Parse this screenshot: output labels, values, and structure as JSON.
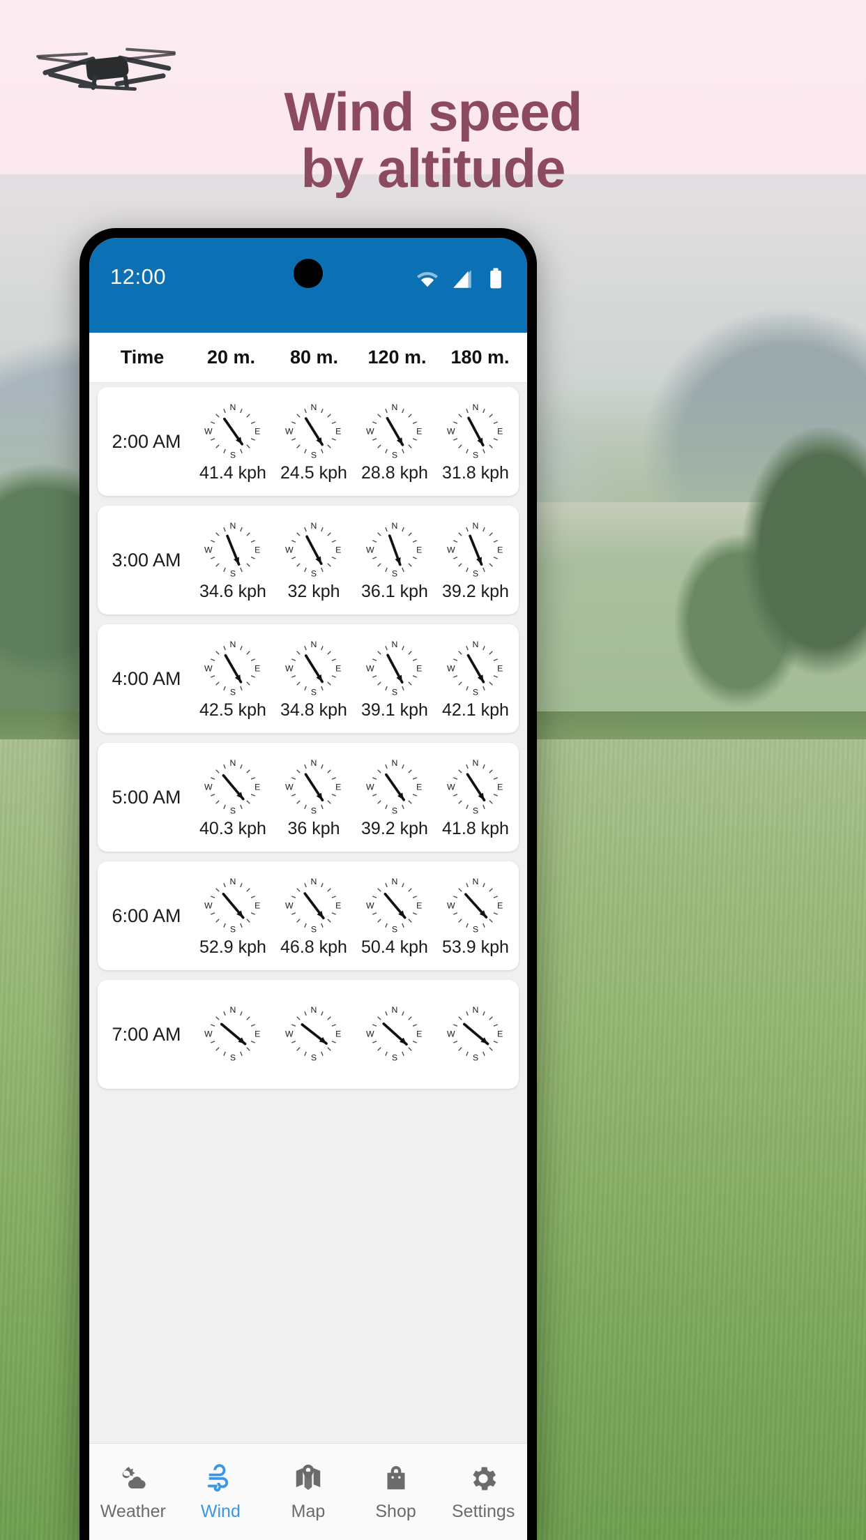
{
  "promo": {
    "headline_line1": "Wind speed",
    "headline_line2": "by altitude",
    "headline_color": "#8b4a5e",
    "drone_icon": "drone-icon"
  },
  "statusbar": {
    "time": "12:00",
    "background": "#0b70b4",
    "icons": [
      "wifi-icon",
      "cellular-signal-icon",
      "battery-icon"
    ]
  },
  "table": {
    "headers": [
      "Time",
      "20 m.",
      "80 m.",
      "120 m.",
      "180 m."
    ],
    "rows": [
      {
        "time": "2:00 AM",
        "cells": [
          {
            "speed": "41.4 kph",
            "direction_deg": 145
          },
          {
            "speed": "24.5 kph",
            "direction_deg": 148
          },
          {
            "speed": "28.8 kph",
            "direction_deg": 150
          },
          {
            "speed": "31.8 kph",
            "direction_deg": 152
          }
        ]
      },
      {
        "time": "3:00 AM",
        "cells": [
          {
            "speed": "34.6 kph",
            "direction_deg": 158
          },
          {
            "speed": "32 kph",
            "direction_deg": 152
          },
          {
            "speed": "36.1 kph",
            "direction_deg": 160
          },
          {
            "speed": "39.2 kph",
            "direction_deg": 158
          }
        ]
      },
      {
        "time": "4:00 AM",
        "cells": [
          {
            "speed": "42.5 kph",
            "direction_deg": 150
          },
          {
            "speed": "34.8 kph",
            "direction_deg": 148
          },
          {
            "speed": "39.1 kph",
            "direction_deg": 152
          },
          {
            "speed": "42.1 kph",
            "direction_deg": 150
          }
        ]
      },
      {
        "time": "5:00 AM",
        "cells": [
          {
            "speed": "40.3 kph",
            "direction_deg": 140
          },
          {
            "speed": "36 kph",
            "direction_deg": 147
          },
          {
            "speed": "39.2 kph",
            "direction_deg": 145
          },
          {
            "speed": "41.8 kph",
            "direction_deg": 147
          }
        ]
      },
      {
        "time": "6:00 AM",
        "cells": [
          {
            "speed": "52.9 kph",
            "direction_deg": 140
          },
          {
            "speed": "46.8 kph",
            "direction_deg": 143
          },
          {
            "speed": "50.4 kph",
            "direction_deg": 140
          },
          {
            "speed": "53.9 kph",
            "direction_deg": 138
          }
        ]
      },
      {
        "time": "7:00 AM",
        "cells": [
          {
            "speed": "",
            "direction_deg": 130
          },
          {
            "speed": "",
            "direction_deg": 128
          },
          {
            "speed": "",
            "direction_deg": 132
          },
          {
            "speed": "",
            "direction_deg": 130
          }
        ]
      }
    ],
    "compass_labels": {
      "n": "N",
      "e": "E",
      "s": "S",
      "w": "W"
    }
  },
  "bottom_nav": {
    "active_color": "#3b96e3",
    "inactive_color": "#6b6b6b",
    "items": [
      {
        "label": "Weather",
        "icon": "sun-cloud-icon",
        "active": false
      },
      {
        "label": "Wind",
        "icon": "wind-icon",
        "active": true
      },
      {
        "label": "Map",
        "icon": "map-pin-icon",
        "active": false
      },
      {
        "label": "Shop",
        "icon": "shopping-bag-icon",
        "active": false
      },
      {
        "label": "Settings",
        "icon": "gear-icon",
        "active": false
      }
    ]
  }
}
